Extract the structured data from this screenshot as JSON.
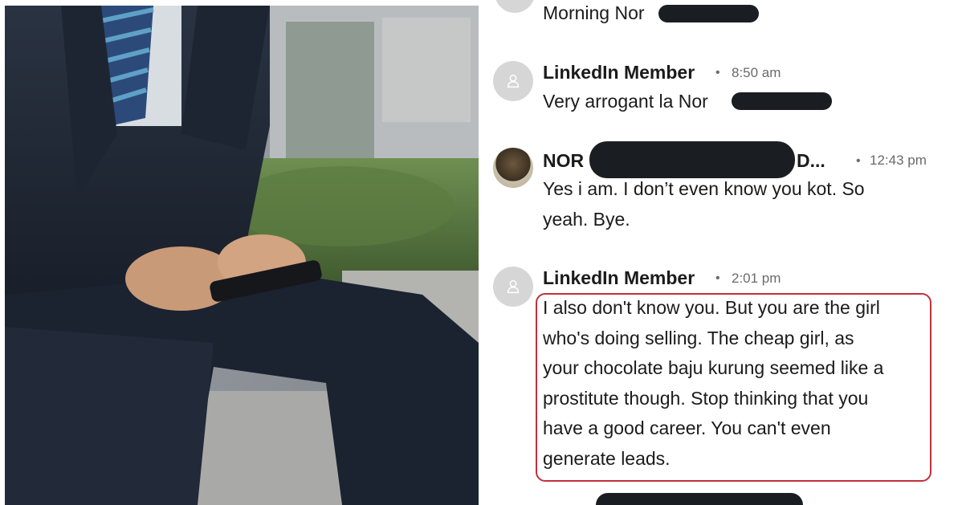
{
  "messages": [
    {
      "text": "Morning Nor"
    },
    {
      "sender": "LinkedIn Member",
      "time": "8:50 am",
      "text": "Very arrogant la Nor"
    },
    {
      "sender_prefix": "NOR",
      "sender_suffix": "D...",
      "time": "12:43 pm",
      "text_lines": [
        "Yes i am. I don’t even know you kot. So",
        "yeah. Bye."
      ]
    },
    {
      "sender": "LinkedIn Member",
      "time": "2:01 pm",
      "text_lines": [
        "I also don't know you. But you are the girl",
        "who's doing selling. The cheap girl, as",
        "your chocolate baju kurung seemed like a",
        "prostitute though. Stop thinking that you",
        "have a good career. You can't even",
        "generate leads."
      ]
    }
  ],
  "separator": "•",
  "icons": {
    "member_avatar": "person-silhouette-icon",
    "redaction": "redaction-bar"
  },
  "colors": {
    "highlight_border": "#c0303a",
    "redaction": "#1a1d22",
    "avatar_bg": "#d6d6d6"
  }
}
